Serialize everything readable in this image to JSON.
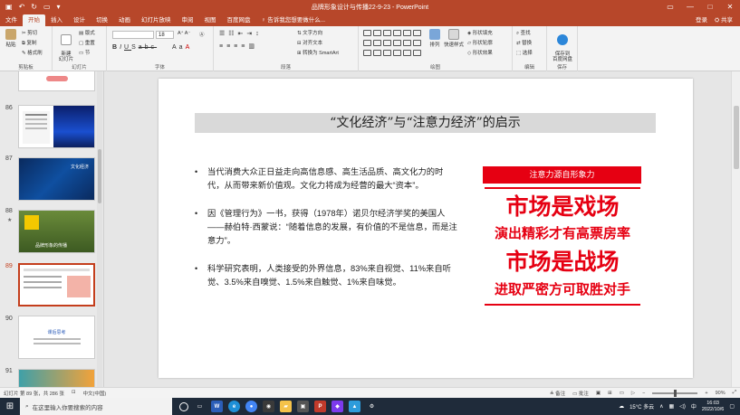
{
  "window": {
    "title": "品牌形象设计与传播22-9-23 - PowerPoint",
    "login": "登录",
    "share": "共享"
  },
  "tabs": [
    "文件",
    "开始",
    "插入",
    "设计",
    "切换",
    "动画",
    "幻灯片放映",
    "审阅",
    "视图",
    "百度网盘"
  ],
  "tell_me": "告诉我您想要做什么...",
  "ribbon": {
    "paste": "粘贴",
    "cut": "剪切",
    "copy": "复制",
    "format_painter": "格式刷",
    "new_slide": "新建\n幻灯片",
    "layout": "版式",
    "reset": "重置",
    "section": "节",
    "font_size": "18",
    "text_direction": "文字方向",
    "align_text": "对齐文本",
    "smartart": "转换为 SmartArt",
    "arrange": "排列",
    "quick_styles": "快速样式",
    "shape_fill": "形状填充",
    "shape_outline": "形状轮廓",
    "shape_effects": "形状效果",
    "find": "查找",
    "replace": "替换",
    "select": "选择",
    "save_baidu": "保存到\n百度网盘",
    "groups": {
      "clipboard": "剪贴板",
      "slides": "幻灯片",
      "font": "字体",
      "paragraph": "段落",
      "drawing": "绘图",
      "editing": "编辑",
      "save": "保存"
    }
  },
  "thumbnails": [
    {
      "num": "86"
    },
    {
      "num": "87",
      "caption": "文化经济"
    },
    {
      "num": "88",
      "caption": "品牌形象的传播"
    },
    {
      "num": "89"
    },
    {
      "num": "90",
      "caption": "课后思考"
    },
    {
      "num": "91"
    }
  ],
  "slide": {
    "title": "“文化经济”与“注意力经济”的启示",
    "bullets": [
      "当代消费大众正日益走向高信息感、高生活品质、高文化力的时代，从而带来新价值观。文化力将成为经营的最大“资本”。",
      "因《管理行为》一书，获得（1978年）诺贝尔经济学奖的美国人——赫伯特·西蒙说：“随着信息的发展，有价值的不是信息，而是注意力”。",
      "科学研究表明，人类接受的外界信息，83%来自视觉、11%来自听觉、3.5%来自嗅觉、1.5%来自触觉、1%来自味觉。"
    ],
    "red_banner": "注意力源自形象力",
    "line1": "市场是戏场",
    "line2": "演出精彩才有高票房率",
    "line3": "市场是战场",
    "line4": "进取严密方可取胜对手"
  },
  "status": {
    "slide_info": "幻灯片 第 89 张，共 286 张",
    "language": "中文(中国)",
    "notes": "备注",
    "comments": "批注",
    "zoom": "90%"
  },
  "taskbar": {
    "search_placeholder": "在这里输入你要搜索的内容",
    "weather": "15°C 多云",
    "time": "16:03",
    "date": "2022/10/6"
  },
  "colors": {
    "accent": "#b7472a",
    "slide_red": "#e60012"
  }
}
